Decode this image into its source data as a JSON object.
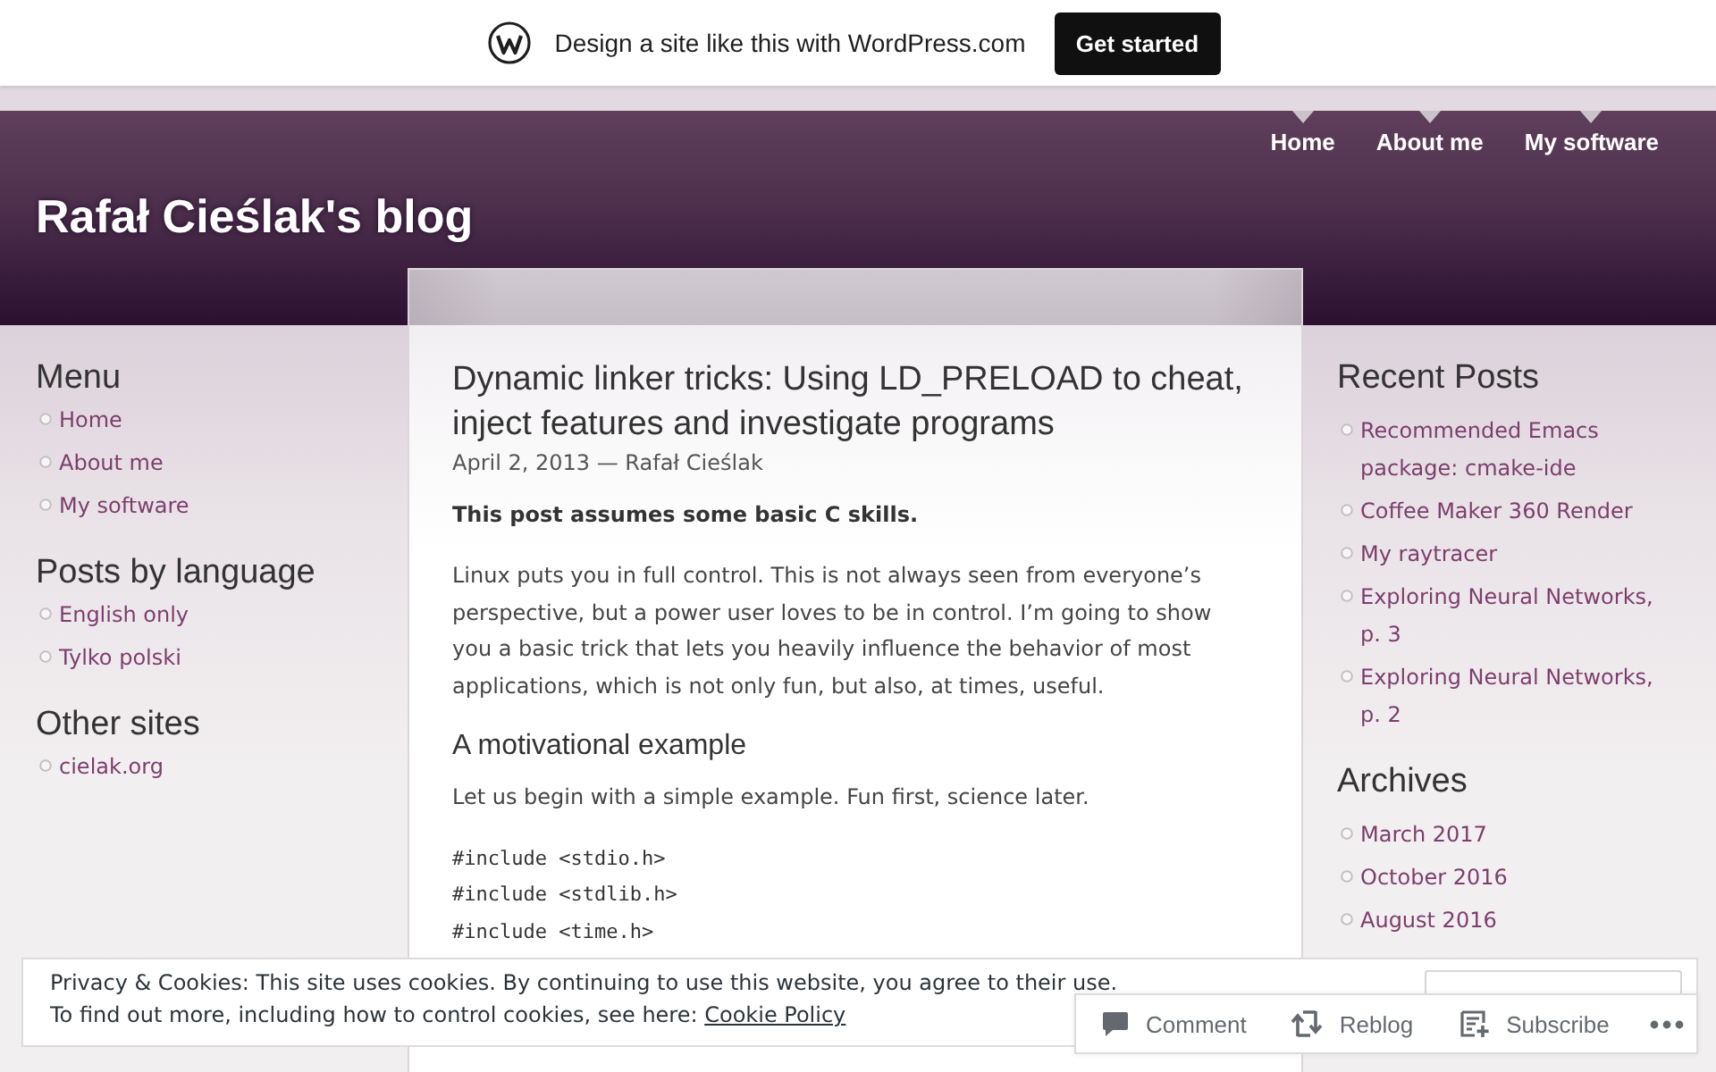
{
  "promo_bar": {
    "text": "Design a site like this with WordPress.com",
    "button": "Get started"
  },
  "header": {
    "title": "Rafał Cieślak's blog",
    "nav": [
      {
        "label": "Home"
      },
      {
        "label": "About me"
      },
      {
        "label": "My software"
      }
    ]
  },
  "left_sidebar": [
    {
      "heading": "Menu",
      "items": [
        "Home",
        "About me",
        "My software"
      ]
    },
    {
      "heading": "Posts by language",
      "items": [
        "English only",
        "Tylko polski"
      ]
    },
    {
      "heading": "Other sites",
      "items": [
        "cielak.org"
      ]
    }
  ],
  "post": {
    "title": "Dynamic linker tricks: Using LD_PRELOAD to cheat, inject features and investigate programs",
    "meta": "April 2, 2013 — Rafał Cieślak",
    "blocks": [
      {
        "kind": "lead",
        "text": "This post assumes some basic C skills."
      },
      {
        "kind": "paragraph",
        "text": "Linux puts you in full control. This is not always seen from everyone’s perspective, but a power user loves to be in control. I’m going to show you a basic trick that lets you heavily influence the behavior of most applications, which is not only fun, but also, at times, useful."
      },
      {
        "kind": "heading",
        "text": "A motivational example"
      },
      {
        "kind": "paragraph",
        "text": "Let us begin with a simple example. Fun first, science later."
      },
      {
        "kind": "code",
        "lines": [
          "#include <stdio.h>",
          "#include <stdlib.h>",
          "#include <time.h>"
        ]
      }
    ]
  },
  "right_sidebar": [
    {
      "heading": "Recent Posts",
      "items": [
        "Recommended Emacs package: cmake-ide",
        "Coffee Maker 360 Render",
        "My raytracer",
        "Exploring Neural Networks, p. 3",
        "Exploring Neural Networks, p. 2"
      ]
    },
    {
      "heading": "Archives",
      "items": [
        "March 2017",
        "October 2016",
        "August 2016"
      ]
    }
  ],
  "cookie_banner": {
    "text": "Privacy & Cookies: This site uses cookies. By continuing to use this website, you agree to their use.",
    "more_text": "To find out more, including how to control cookies, see here:",
    "link": "Cookie Policy"
  },
  "action_bar": {
    "items": [
      {
        "kind": "comment",
        "label": "Comment"
      },
      {
        "kind": "reblog",
        "label": "Reblog"
      },
      {
        "kind": "subscribe",
        "label": "Subscribe"
      }
    ]
  }
}
